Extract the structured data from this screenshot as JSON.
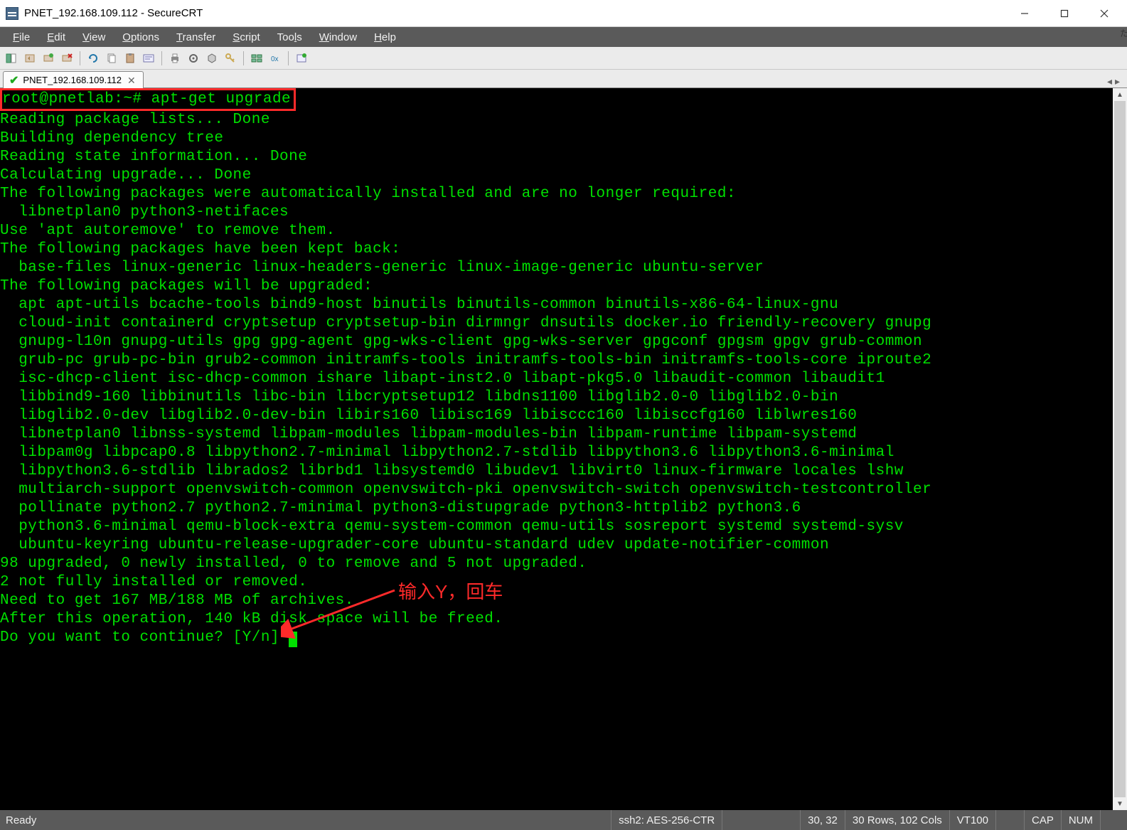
{
  "window": {
    "title": "PNET_192.168.109.112 - SecureCRT"
  },
  "menu": {
    "items": [
      "File",
      "Edit",
      "View",
      "Options",
      "Transfer",
      "Script",
      "Tools",
      "Window",
      "Help"
    ]
  },
  "toolbar": {
    "icons": [
      "session-mgr-icon",
      "quick-connect-icon",
      "connect-icon",
      "disconnect-icon",
      "|",
      "copy-icon",
      "paste-icon",
      "find-icon",
      "|",
      "print-icon",
      "settings-icon",
      "raw-log-icon",
      "|",
      "key-icon",
      "wrench-icon",
      "gear-icon",
      "|",
      "hex-icon",
      "script-icon",
      "|",
      "new-tab-icon"
    ]
  },
  "tab": {
    "label": "PNET_192.168.109.112"
  },
  "terminal": {
    "prompt": "root@pnetlab:~# apt-get upgrade",
    "lines": [
      "Reading package lists... Done",
      "Building dependency tree",
      "Reading state information... Done",
      "Calculating upgrade... Done",
      "The following packages were automatically installed and are no longer required:",
      "  libnetplan0 python3-netifaces",
      "Use 'apt autoremove' to remove them.",
      "The following packages have been kept back:",
      "  base-files linux-generic linux-headers-generic linux-image-generic ubuntu-server",
      "The following packages will be upgraded:",
      "  apt apt-utils bcache-tools bind9-host binutils binutils-common binutils-x86-64-linux-gnu",
      "  cloud-init containerd cryptsetup cryptsetup-bin dirmngr dnsutils docker.io friendly-recovery gnupg",
      "  gnupg-l10n gnupg-utils gpg gpg-agent gpg-wks-client gpg-wks-server gpgconf gpgsm gpgv grub-common",
      "  grub-pc grub-pc-bin grub2-common initramfs-tools initramfs-tools-bin initramfs-tools-core iproute2",
      "  isc-dhcp-client isc-dhcp-common ishare libapt-inst2.0 libapt-pkg5.0 libaudit-common libaudit1",
      "  libbind9-160 libbinutils libc-bin libcryptsetup12 libdns1100 libglib2.0-0 libglib2.0-bin",
      "  libglib2.0-dev libglib2.0-dev-bin libirs160 libisc169 libisccc160 libisccfg160 liblwres160",
      "  libnetplan0 libnss-systemd libpam-modules libpam-modules-bin libpam-runtime libpam-systemd",
      "  libpam0g libpcap0.8 libpython2.7-minimal libpython2.7-stdlib libpython3.6 libpython3.6-minimal",
      "  libpython3.6-stdlib librados2 librbd1 libsystemd0 libudev1 libvirt0 linux-firmware locales lshw",
      "  multiarch-support openvswitch-common openvswitch-pki openvswitch-switch openvswitch-testcontroller",
      "  pollinate python2.7 python2.7-minimal python3-distupgrade python3-httplib2 python3.6",
      "  python3.6-minimal qemu-block-extra qemu-system-common qemu-utils sosreport systemd systemd-sysv",
      "  ubuntu-keyring ubuntu-release-upgrader-core ubuntu-standard udev update-notifier-common",
      "98 upgraded, 0 newly installed, 0 to remove and 5 not upgraded.",
      "2 not fully installed or removed.",
      "Need to get 167 MB/188 MB of archives.",
      "After this operation, 140 kB disk space will be freed.",
      "Do you want to continue? [Y/n] "
    ]
  },
  "annotation": {
    "text": "输入Y，回车"
  },
  "status": {
    "left": "Ready",
    "cipher": "ssh2: AES-256-CTR",
    "pos": "30, 32",
    "dims": "30 Rows, 102 Cols",
    "term": "VT100",
    "cap": "CAP",
    "num": "NUM"
  }
}
